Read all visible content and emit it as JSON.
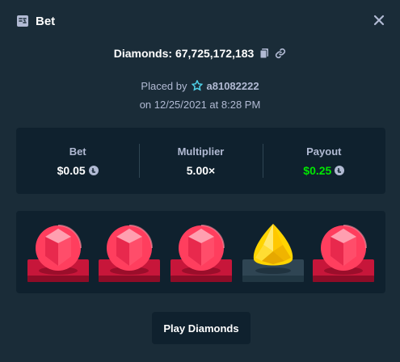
{
  "header": {
    "title": "Bet",
    "icon": "bet-slip-icon",
    "close_icon": "close-icon"
  },
  "game": {
    "label": "Diamonds: 67,725,172,183",
    "copy_icon": "copy-icon",
    "link_icon": "link-icon"
  },
  "placed": {
    "prefix": "Placed by",
    "username": "a81082222",
    "vip_icon": "vip-star-icon",
    "date": "on 12/25/2021 at 8:28 PM"
  },
  "stats": {
    "bet": {
      "label": "Bet",
      "value": "$0.05"
    },
    "multiplier": {
      "label": "Multiplier",
      "value": "5.00×"
    },
    "payout": {
      "label": "Payout",
      "value": "$0.25"
    },
    "currency_icon": "litecoin-icon"
  },
  "board": {
    "gems": [
      {
        "type": "red",
        "icon": "red-gem-icon"
      },
      {
        "type": "red",
        "icon": "red-gem-icon"
      },
      {
        "type": "red",
        "icon": "red-gem-icon"
      },
      {
        "type": "yellow",
        "icon": "yellow-gem-icon"
      },
      {
        "type": "red",
        "icon": "red-gem-icon"
      }
    ]
  },
  "actions": {
    "play_label": "Play Diamonds"
  },
  "colors": {
    "background": "#1a2c38",
    "panel": "#0f212e",
    "payout_green": "#00e701",
    "red_gem": "#ff3e5e",
    "yellow_gem": "#ffd400"
  }
}
